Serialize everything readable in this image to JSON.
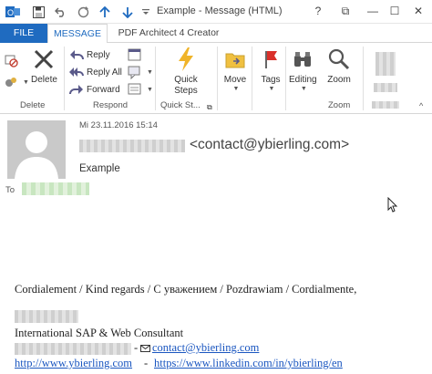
{
  "window": {
    "title": "Example - Message (HTML)",
    "help_symbol": "?",
    "restore_symbol": "⧉",
    "minimize_symbol": "—",
    "maximize_symbol": "☐",
    "close_symbol": "✕"
  },
  "tabs": [
    {
      "label": "FILE"
    },
    {
      "label": "MESSAGE"
    },
    {
      "label": "PDF Architect 4 Creator"
    }
  ],
  "ribbon": {
    "delete_group": {
      "delete_label": "Delete",
      "group_label": "Delete"
    },
    "respond_group": {
      "reply": "Reply",
      "reply_all": "Reply All",
      "forward": "Forward",
      "group_label": "Respond"
    },
    "quick_steps_group": {
      "label_line1": "Quick",
      "label_line2": "Steps",
      "group_label": "Quick St..."
    },
    "move": {
      "label": "Move"
    },
    "tags": {
      "label": "Tags"
    },
    "editing": {
      "label": "Editing"
    },
    "zoom": {
      "label": "Zoom",
      "group_label": "Zoom"
    }
  },
  "message": {
    "date": "Mi 23.11.2016 15:14",
    "sender_email": "<contact@ybierling.com>",
    "subject": "Example",
    "to_label": "To"
  },
  "body": {
    "greeting": "Cordialement / Kind regards / С уважением / Pozdrawiam / Cordialmente,",
    "title_line": "International SAP & Web Consultant",
    "separator": "-",
    "email_link": "contact@ybierling.com",
    "website_link": "http://www.ybierling.com",
    "linkedin_link": "https://www.linkedin.com/in/ybierling/en"
  },
  "colors": {
    "accent": "#1f6bc0",
    "link": "#1a56c0"
  }
}
